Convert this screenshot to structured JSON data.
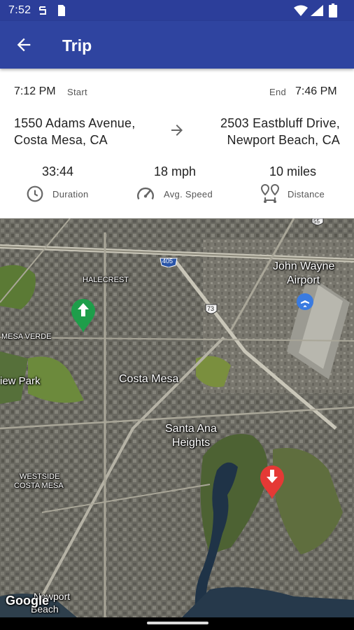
{
  "status_bar": {
    "time": "7:52",
    "icons": [
      "sync-icon",
      "sim-card-icon",
      "wifi-icon",
      "signal-icon",
      "battery-icon"
    ]
  },
  "app_bar": {
    "title": "Trip",
    "back_icon": "arrow-left-icon",
    "color": "#2f44a0"
  },
  "trip": {
    "start_time": "7:12 PM",
    "start_label": "Start",
    "end_label": "End",
    "end_time": "7:46 PM",
    "start_address": {
      "line1": "1550 Adams Avenue,",
      "line2": "Costa Mesa, CA"
    },
    "end_address": {
      "line1": "2503 Eastbluff Drive,",
      "line2": "Newport Beach, CA"
    },
    "stats": {
      "duration": {
        "value": "33:44",
        "label": "Duration",
        "icon": "clock-icon"
      },
      "avg_speed": {
        "value": "18 mph",
        "label": "Avg. Speed",
        "icon": "speedometer-icon"
      },
      "distance": {
        "value": "10 miles",
        "label": "Distance",
        "icon": "route-icon"
      }
    }
  },
  "map": {
    "labels": {
      "halecrest": "HALECREST",
      "mesa_verde": "MESA VERDE",
      "view_park": "iew Park",
      "costa_mesa": "Costa Mesa",
      "santa_ana_heights_1": "Santa Ana",
      "santa_ana_heights_2": "Heights",
      "westside_1": "WESTSIDE",
      "westside_2": "COSTA MESA",
      "airport_1": "John Wayne",
      "airport_2": "Airport",
      "newport_1": "Newport",
      "newport_2": "Beach",
      "road_405": "405",
      "road_73": "73",
      "road_55": "55",
      "attribution": "Google"
    },
    "start_marker_color": "#1e9e4a",
    "end_marker_color": "#e53935"
  }
}
